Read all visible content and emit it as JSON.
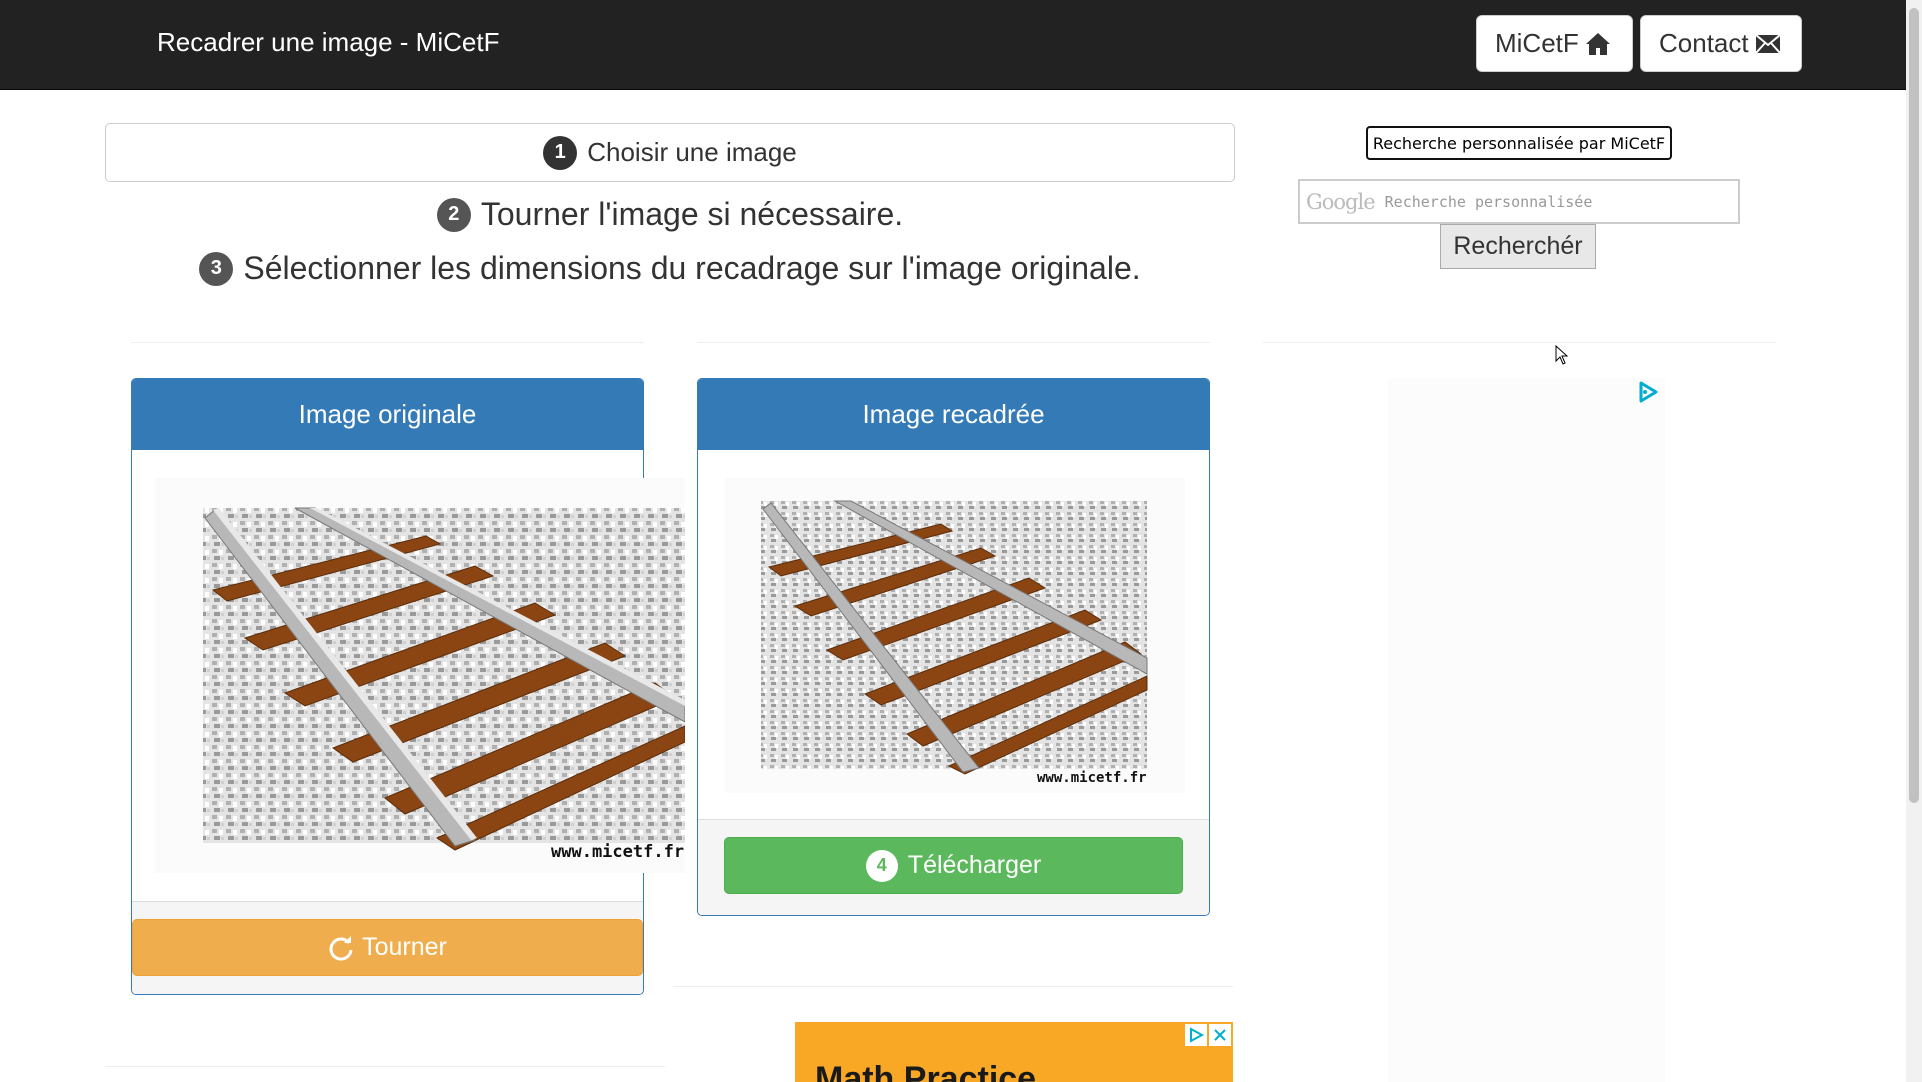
{
  "navbar": {
    "brand": "Recadrer une image - MiCetF",
    "home_label": "MiCetF",
    "contact_label": "Contact"
  },
  "steps": {
    "choose_label": "Choisir une image",
    "step1_num": "1",
    "step2_num": "2",
    "step2_text": "Tourner l'image si nécessaire.",
    "step3_num": "3",
    "step3_text": "Sélectionner les dimensions du recadrage sur l'image originale."
  },
  "panels": {
    "original_title": "Image originale",
    "cropped_title": "Image recadrée",
    "rotate_label": "Tourner",
    "download_num": "4",
    "download_label": "Télécharger",
    "watermark": "www.micetf.fr"
  },
  "search": {
    "title": "Recherche personnalisée par MiCetF",
    "google_logo": "Google",
    "placeholder": "Recherche personnalisée",
    "button_label": "Recherchér"
  },
  "ad": {
    "banner_text": "Math Practice"
  },
  "colors": {
    "navbar_bg": "#222222",
    "panel_primary": "#337ab7",
    "warning": "#f0ad4e",
    "success": "#5cb85c",
    "ad_orange": "#f9a825"
  }
}
